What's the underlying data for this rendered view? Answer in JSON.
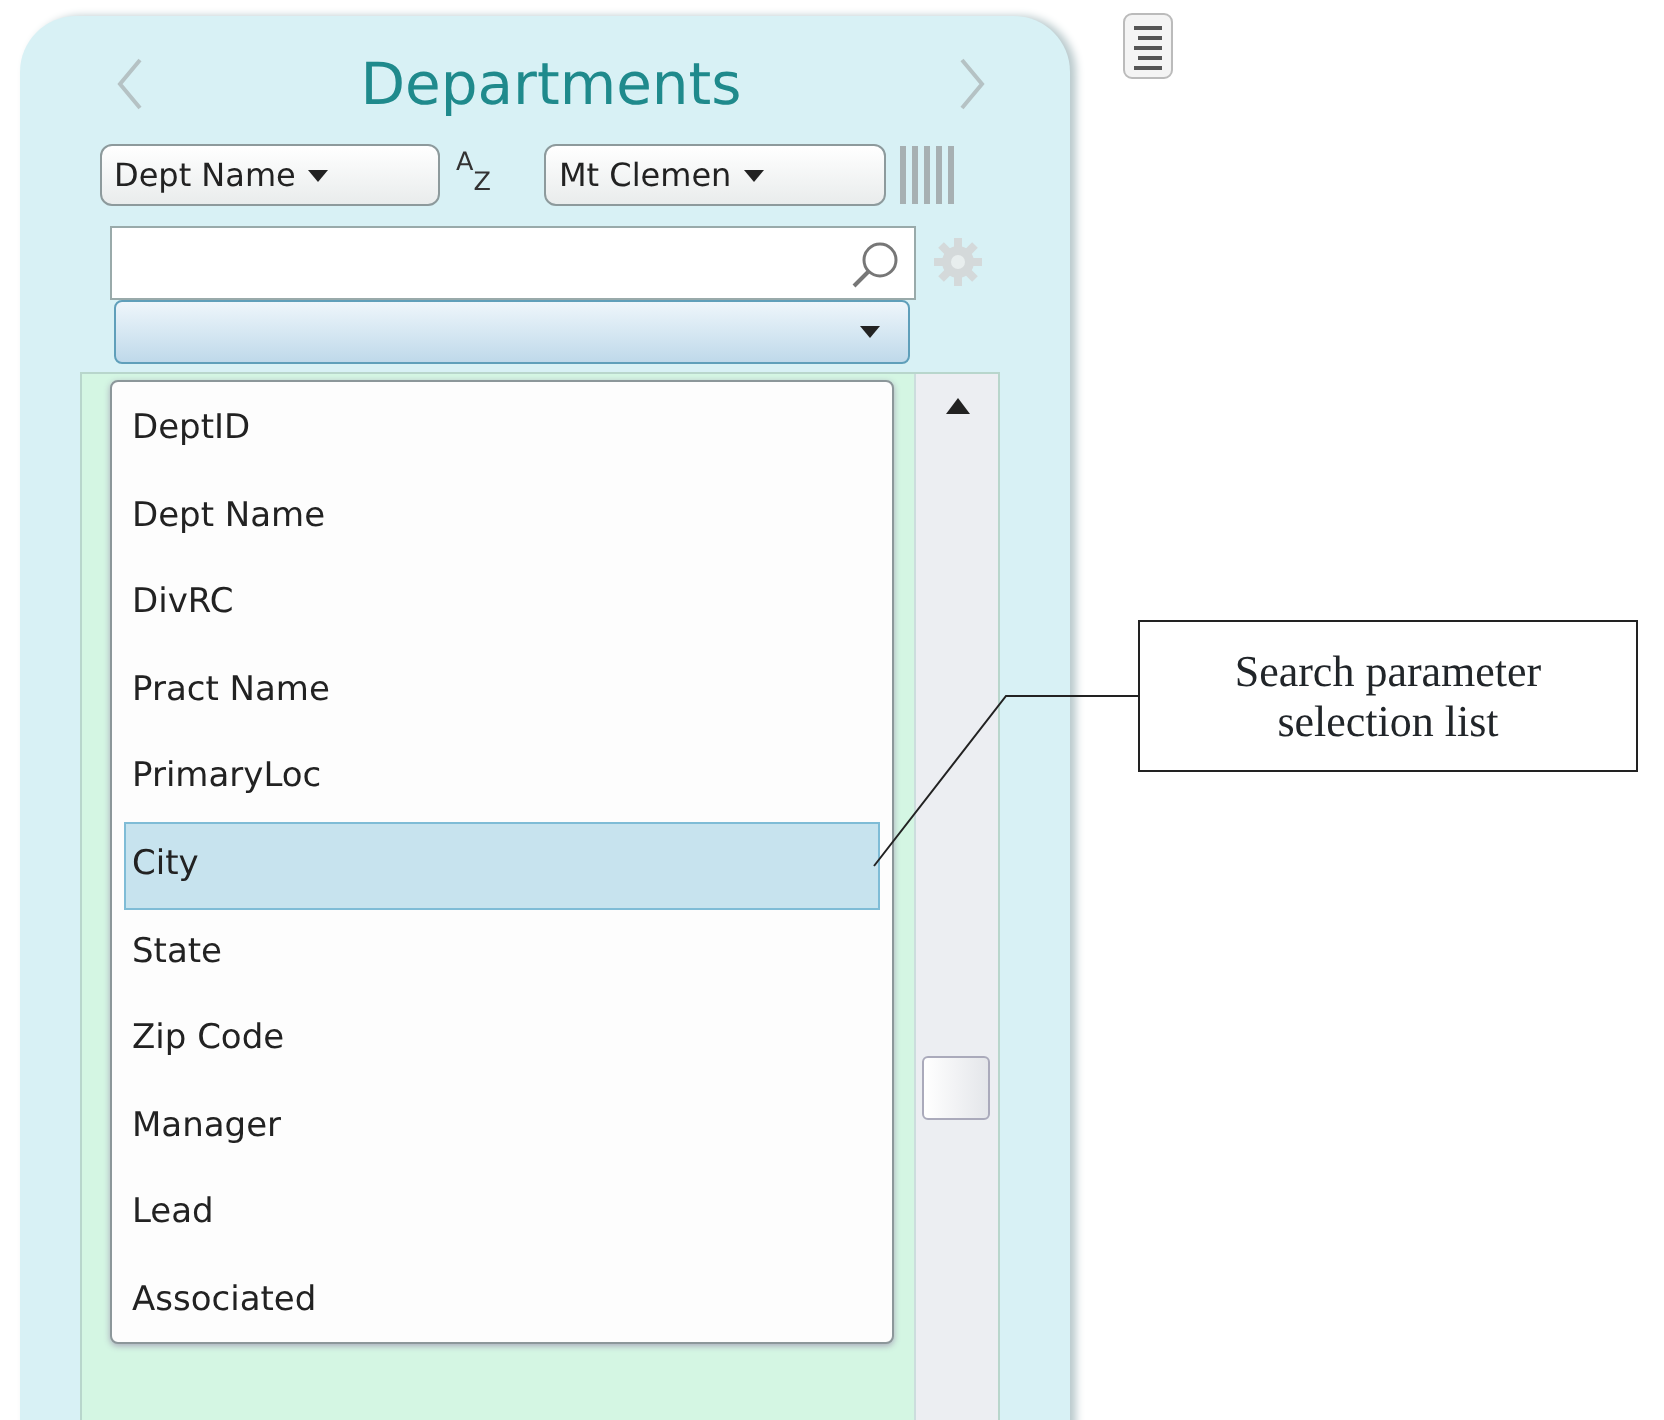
{
  "panel": {
    "title": "Departments",
    "sort_button": "Dept Name",
    "sort_order": "$^{A}$$_{Z}$",
    "location_button": "Mt Clemen",
    "parameter_list": [
      {
        "label": "DeptID",
        "selected": false
      },
      {
        "label": "Dept Name",
        "selected": false
      },
      {
        "label": "DivRC",
        "selected": false
      },
      {
        "label": "Pract Name",
        "selected": false
      },
      {
        "label": "PrimaryLoc",
        "selected": false
      },
      {
        "label": "City",
        "selected": true
      },
      {
        "label": "State",
        "selected": false
      },
      {
        "label": "Zip Code",
        "selected": false
      },
      {
        "label": "Manager",
        "selected": false
      },
      {
        "label": "Lead",
        "selected": false
      },
      {
        "label": "Associated",
        "selected": false
      }
    ]
  },
  "callout": {
    "text": "Search parameter selection list"
  }
}
